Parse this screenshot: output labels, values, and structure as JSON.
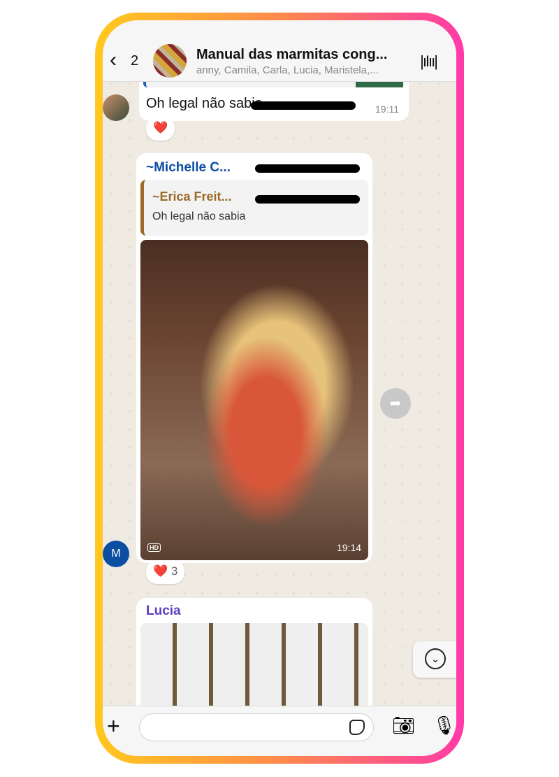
{
  "header": {
    "back_count": "2",
    "title": "Manual das marmitas cong...",
    "members": "anny, Camila, Carla, Lucia, Maristela,..."
  },
  "messages": [
    {
      "text": "Oh legal não sabia",
      "time": "19:11",
      "reaction": "❤️"
    },
    {
      "sender": "~Michelle C...",
      "quote_sender": "~Erica Freit...",
      "quote_text": "Oh legal não sabia",
      "image_badge": "HD",
      "time": "19:14",
      "reaction": "❤️",
      "reaction_count": "3",
      "avatar_letter": "M"
    },
    {
      "sender": "Lucia"
    }
  ],
  "colors": {
    "michelle": "#0b4ea2",
    "erica": "#9a6b2a",
    "lucia": "#5a3fbf"
  }
}
